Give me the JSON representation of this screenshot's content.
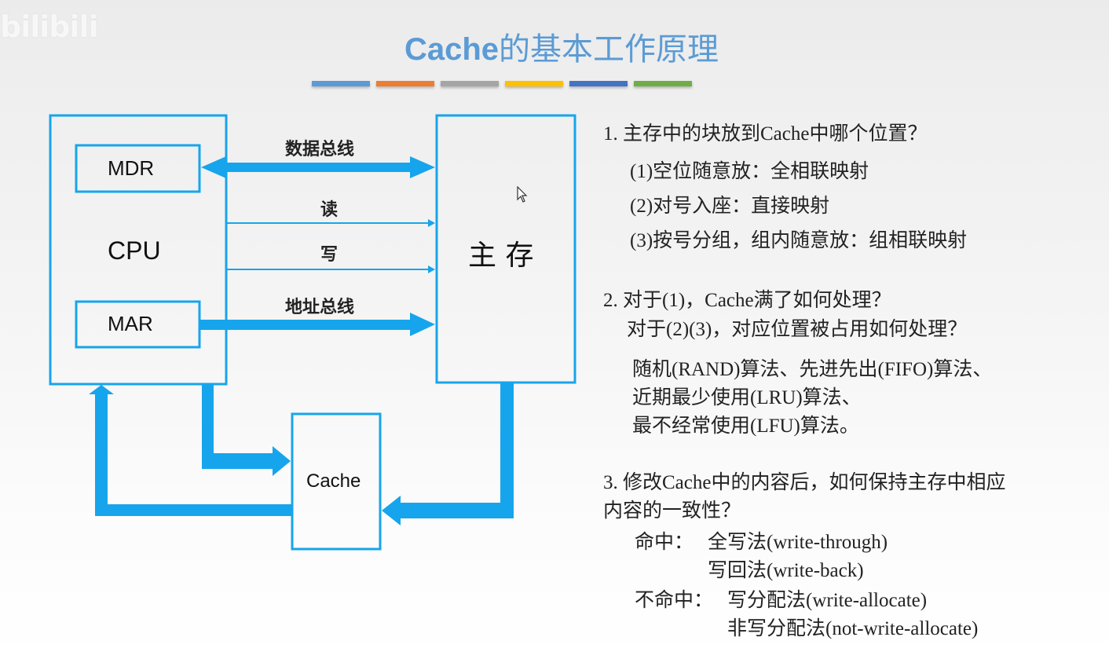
{
  "watermark": "bilibili",
  "title": {
    "latin": "Cache",
    "cjk": "的基本工作原理"
  },
  "color_bars": [
    "#5b9bd5",
    "#ed7d31",
    "#a5a5a5",
    "#ffc000",
    "#4472c4",
    "#70ad47"
  ],
  "diagram": {
    "accent_color": "#16a5ec",
    "boxes": {
      "cpu": "CPU",
      "mdr": "MDR",
      "mar": "MAR",
      "main_memory": "主 存",
      "cache": "Cache"
    },
    "buses": {
      "data_bus": "数据总线",
      "read": "读",
      "write": "写",
      "address_bus": "地址总线"
    }
  },
  "notes": {
    "q1": {
      "question": "1. 主存中的块放到Cache中哪个位置？",
      "answers": [
        "(1)空位随意放：全相联映射",
        "(2)对号入座：直接映射",
        "(3)按号分组，组内随意放：组相联映射"
      ]
    },
    "q2": {
      "question_line1": "2. 对于(1)，Cache满了如何处理？",
      "question_line2": "对于(2)(3)，对应位置被占用如何处理？",
      "answers": [
        "随机(RAND)算法、先进先出(FIFO)算法、",
        "近期最少使用(LRU)算法、",
        "最不经常使用(LFU)算法。"
      ]
    },
    "q3": {
      "question_line1": "3. 修改Cache中的内容后，如何保持主存中相应",
      "question_line2": "内容的一致性？",
      "hit_label": "命中：",
      "hit_answers": [
        "全写法(write-through)",
        "写回法(write-back)"
      ],
      "miss_label": "不命中：",
      "miss_answers": [
        "写分配法(write-allocate)",
        "非写分配法(not-write-allocate)"
      ]
    }
  }
}
